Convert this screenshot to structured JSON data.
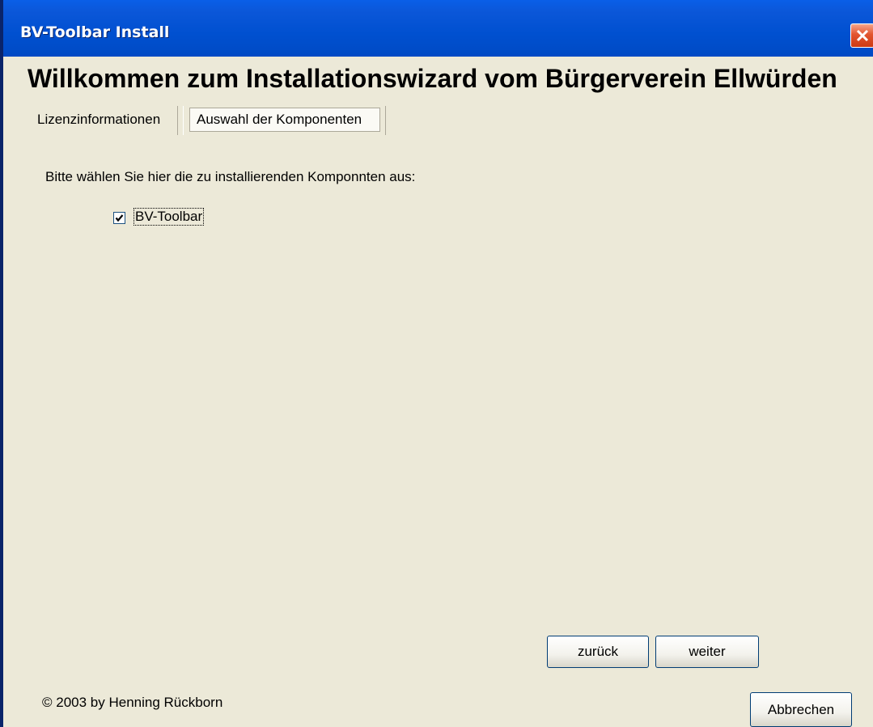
{
  "window": {
    "title": "BV-Toolbar Install"
  },
  "heading": "Willkommen zum Installationswizard vom Bürgerverein Ellwürden",
  "tabs": [
    {
      "label": "Lizenzinformationen",
      "selected": false
    },
    {
      "label": "Auswahl der Komponenten",
      "selected": true
    }
  ],
  "content": {
    "instruction": "Bitte wählen Sie hier die zu installierenden Komponnten aus:",
    "components": [
      {
        "label": "BV-Toolbar",
        "checked": true
      }
    ]
  },
  "buttons": {
    "back": "zurück",
    "next": "weiter",
    "cancel": "Abbrechen"
  },
  "footer": {
    "copyright": "© 2003 by Henning Rückborn"
  },
  "icons": {
    "close": "close-icon",
    "check": "checkmark-icon"
  },
  "colors": {
    "titlebar": "#0054e3",
    "close_button": "#e2552f",
    "window_background": "#ece9d8"
  }
}
